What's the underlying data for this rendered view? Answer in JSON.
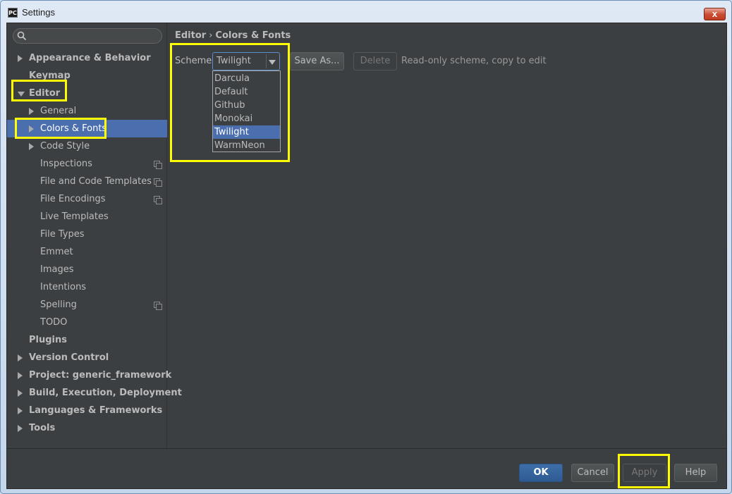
{
  "window": {
    "title": "Settings",
    "app_icon_text": "PC",
    "close_glyph": "x"
  },
  "sidebar": {
    "search_placeholder": "",
    "items": [
      {
        "label": "Appearance & Behavior",
        "level": 0,
        "arrow": "right",
        "bold": true
      },
      {
        "label": "Keymap",
        "level": 0,
        "arrow": "none",
        "bold": true
      },
      {
        "label": "Editor",
        "level": 0,
        "arrow": "down",
        "bold": true
      },
      {
        "label": "General",
        "level": 1,
        "arrow": "right"
      },
      {
        "label": "Colors & Fonts",
        "level": 1,
        "arrow": "right",
        "selected": true
      },
      {
        "label": "Code Style",
        "level": 1,
        "arrow": "right"
      },
      {
        "label": "Inspections",
        "level": 1,
        "arrow": "none",
        "copy_icon": true
      },
      {
        "label": "File and Code Templates",
        "level": 1,
        "arrow": "none",
        "copy_icon": true
      },
      {
        "label": "File Encodings",
        "level": 1,
        "arrow": "none",
        "copy_icon": true
      },
      {
        "label": "Live Templates",
        "level": 1,
        "arrow": "none"
      },
      {
        "label": "File Types",
        "level": 1,
        "arrow": "none"
      },
      {
        "label": "Emmet",
        "level": 1,
        "arrow": "none"
      },
      {
        "label": "Images",
        "level": 1,
        "arrow": "none"
      },
      {
        "label": "Intentions",
        "level": 1,
        "arrow": "none"
      },
      {
        "label": "Spelling",
        "level": 1,
        "arrow": "none",
        "copy_icon": true
      },
      {
        "label": "TODO",
        "level": 1,
        "arrow": "none"
      },
      {
        "label": "Plugins",
        "level": 0,
        "arrow": "none",
        "bold": true
      },
      {
        "label": "Version Control",
        "level": 0,
        "arrow": "right",
        "bold": true
      },
      {
        "label": "Project: generic_framework",
        "level": 0,
        "arrow": "right",
        "bold": true
      },
      {
        "label": "Build, Execution, Deployment",
        "level": 0,
        "arrow": "right",
        "bold": true
      },
      {
        "label": "Languages & Frameworks",
        "level": 0,
        "arrow": "right",
        "bold": true
      },
      {
        "label": "Tools",
        "level": 0,
        "arrow": "right",
        "bold": true
      }
    ]
  },
  "main": {
    "breadcrumb": [
      "Editor",
      "Colors & Fonts"
    ],
    "breadcrumb_sep": "›",
    "scheme_label": "Scheme:",
    "scheme_value": "Twilight",
    "save_as_label": "Save As...",
    "delete_label": "Delete",
    "readonly_text": "Read-only scheme, copy to edit",
    "scheme_options": [
      "Darcula",
      "Default",
      "Github",
      "Monokai",
      "Twilight",
      "WarmNeon"
    ],
    "selected_option": "Twilight"
  },
  "footer": {
    "ok_label": "OK",
    "cancel_label": "Cancel",
    "apply_label": "Apply",
    "help_label": "Help"
  },
  "watermark_text": "",
  "colors": {
    "background": "#3c3f41",
    "selection": "#4b6eaf",
    "text": "#bbbbbb",
    "highlight": "#ffff00"
  }
}
